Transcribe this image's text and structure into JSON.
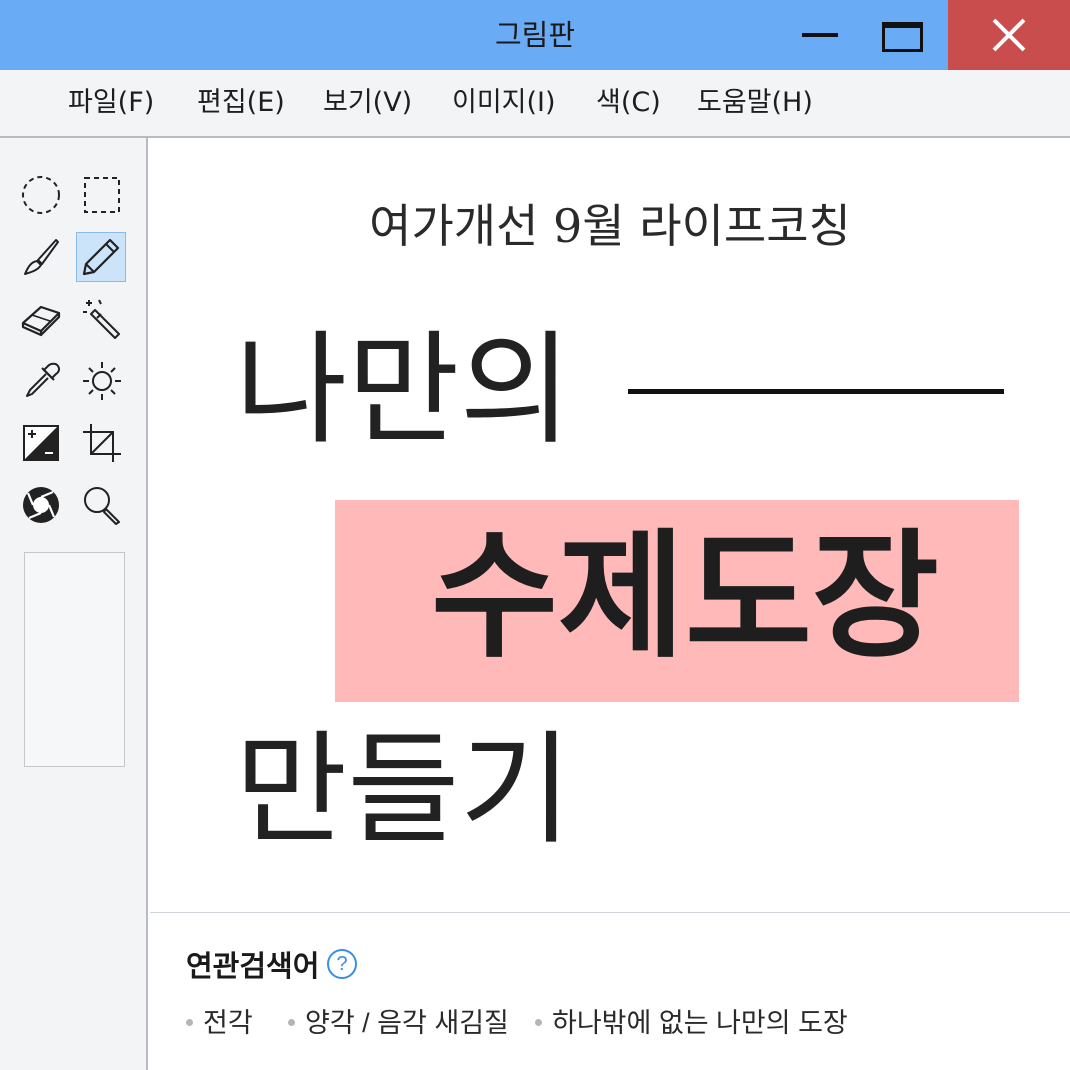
{
  "window": {
    "title": "그림판",
    "controls": {
      "minimize": "minimize-icon",
      "maximize": "maximize-icon",
      "close": "close-icon"
    },
    "colors": {
      "titlebar": "#6aabf5",
      "close_button": "#c94d4d"
    }
  },
  "menu": {
    "items": [
      {
        "label": "파일(F)"
      },
      {
        "label": "편집(E)"
      },
      {
        "label": "보기(V)"
      },
      {
        "label": "이미지(I)"
      },
      {
        "label": "색(C)"
      },
      {
        "label": "도움말(H)"
      }
    ]
  },
  "tools": [
    {
      "icon": "ellipse-select-icon"
    },
    {
      "icon": "rect-select-icon"
    },
    {
      "icon": "brush-icon"
    },
    {
      "icon": "pencil-icon",
      "selected": true
    },
    {
      "icon": "eraser-icon"
    },
    {
      "icon": "magic-wand-icon"
    },
    {
      "icon": "eyedropper-icon"
    },
    {
      "icon": "brightness-icon"
    },
    {
      "icon": "contrast-icon"
    },
    {
      "icon": "crop-icon"
    },
    {
      "icon": "aperture-icon"
    },
    {
      "icon": "magnifier-icon"
    }
  ],
  "canvas": {
    "subtitle": "여가개선 9월 라이프코칭",
    "line1": "나만의",
    "line2": "수제도장",
    "line3": "만들기",
    "highlight_color": "#ffb9b9"
  },
  "related": {
    "title": "연관검색어",
    "help": "?",
    "items": [
      "전각",
      "양각 / 음각 새김질",
      "하나밖에 없는 나만의 도장"
    ]
  }
}
